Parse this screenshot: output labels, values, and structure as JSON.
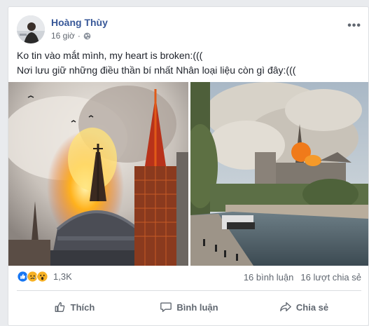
{
  "post": {
    "author": "Hoàng Thùy",
    "time": "16 giờ",
    "privacy_icon": "globe-icon",
    "more_label": "•••",
    "text_line1": "Ko tin vào mắt mình, my heart is broken:(((",
    "text_line2": "Nơi lưu giữ những điều thần bí nhất Nhân loại liệu còn gì đây:((("
  },
  "photos": [
    {
      "icon": "notre-dame-spire-fire-photo"
    },
    {
      "icon": "notre-dame-river-smoke-photo"
    }
  ],
  "stats": {
    "reactions": [
      "like",
      "sad",
      "wow"
    ],
    "reaction_colors": {
      "like": "#1877f2",
      "sad": "#f7b125",
      "wow": "#f7b125"
    },
    "reaction_count": "1,3K",
    "comments": "16 bình luận",
    "shares": "16 lượt chia sẻ"
  },
  "actions": {
    "like": "Thích",
    "comment": "Bình luận",
    "share": "Chia sẻ"
  },
  "colors": {
    "author": "#385898",
    "meta": "#616770",
    "background": "#e9ebee"
  }
}
